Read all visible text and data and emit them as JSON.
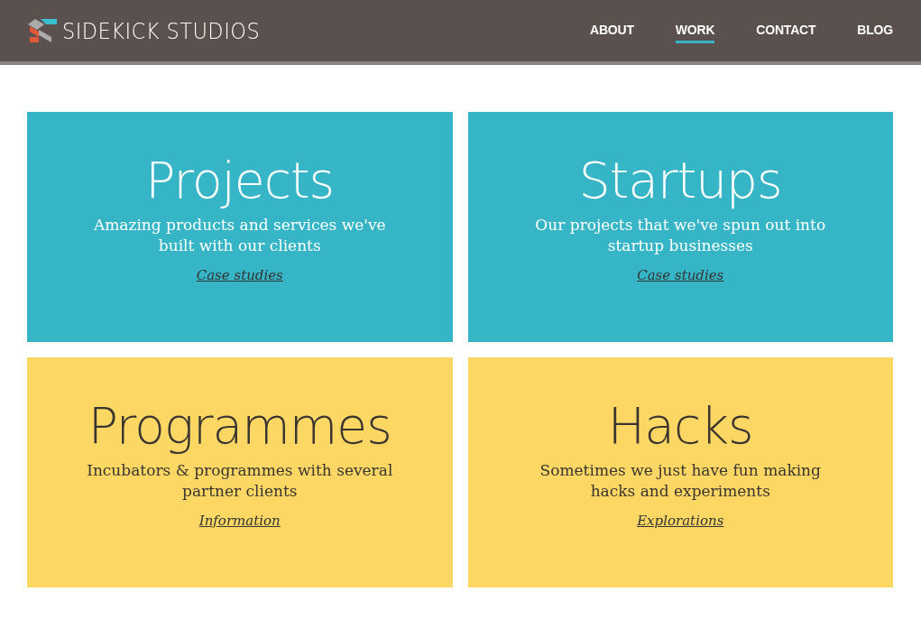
{
  "header": {
    "logo_text": "SIDEKICK STUDIOS",
    "nav": [
      {
        "label": "ABOUT",
        "selected": false
      },
      {
        "label": "WORK",
        "selected": true
      },
      {
        "label": "CONTACT",
        "selected": false
      },
      {
        "label": "BLOG",
        "selected": false
      }
    ]
  },
  "cards": [
    {
      "title": "Projects",
      "description": "Amazing products and services we've built with our clients",
      "link": "Case studies",
      "color": "#36b5c6"
    },
    {
      "title": "Startups",
      "description": "Our projects that we've spun out into startup businesses",
      "link": "Case studies",
      "color": "#36b5c6"
    },
    {
      "title": "Programmes",
      "description": "Incubators & programmes with several partner clients",
      "link": "Information",
      "color": "#fcd764"
    },
    {
      "title": "Hacks",
      "description": "Sometimes we just have fun making hacks and experiments",
      "link": "Explorations",
      "color": "#fcd764"
    }
  ]
}
